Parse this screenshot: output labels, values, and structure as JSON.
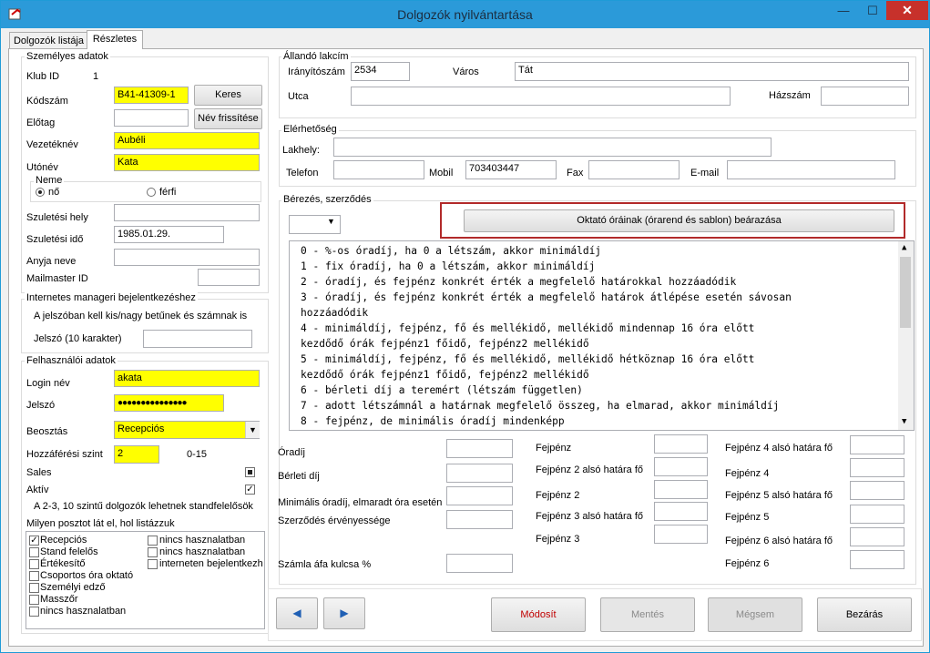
{
  "window": {
    "title": "Dolgozók nyilvántartása",
    "minimize": "—",
    "maximize": "☐",
    "close": "✕"
  },
  "tabs": [
    {
      "label": "Dolgozók listája"
    },
    {
      "label": "Részletes"
    }
  ],
  "personal": {
    "legend": "Személyes adatok",
    "klub_id_label": "Klub ID",
    "klub_id_value": "1",
    "kodszam_label": "Kódszám",
    "kodszam_value": "B41-41309-1",
    "keres_button": "Keres",
    "elotag_label": "Előtag",
    "elotag_value": "",
    "nev_frissites_button": "Név frissítése",
    "vezeteknev_label": "Vezetéknév",
    "vezeteknev_value": "Aubéli",
    "utonev_label": "Utónév",
    "utonev_value": "Kata",
    "neme_legend": "Neme",
    "neme_no": "nő",
    "neme_ferfi": "férfi",
    "szuletesi_hely_label": "Szuletési hely",
    "szuletesi_hely_value": "",
    "szuletesi_ido_label": "Szuletési idő",
    "szuletesi_ido_value": "1985.01.29.",
    "anyja_neve_label": "Anyja neve",
    "anyja_neve_value": "",
    "mailmaster_label": "Mailmaster ID",
    "mailmaster_value": ""
  },
  "internet": {
    "legend": "Internetes manageri bejelentkezéshez",
    "note": "A jelszóban kell kis/nagy betűnek és számnak is",
    "jelszo_label": "Jelszó (10 karakter)",
    "jelszo_value": ""
  },
  "user": {
    "legend": "Felhasználói adatok",
    "login_label": "Login név",
    "login_value": "akata",
    "jelszo_label": "Jelszó",
    "jelszo_value": "●●●●●●●●●●●●●●●",
    "beosztas_label": "Beosztás",
    "beosztas_value": "Recepciós",
    "hozzaferes_label": "Hozzáférési szint",
    "hozzaferes_value": "2",
    "hozzaferes_range": "0-15",
    "sales_label": "Sales",
    "aktiv_label": "Aktív",
    "standfelelos_note": "A 2-3, 10 szintű dolgozók lehetnek standfelelősök",
    "poszt_label": "Milyen posztot lát el, hol listázzuk",
    "posts_left": [
      {
        "label": "Recepciós",
        "checked": true
      },
      {
        "label": "Stand felelős",
        "checked": false
      },
      {
        "label": "Értékesítő",
        "checked": false
      },
      {
        "label": "Csoportos óra oktató",
        "checked": false
      },
      {
        "label": "Személyi edző",
        "checked": false
      },
      {
        "label": "Masszőr",
        "checked": false
      },
      {
        "label": "nincs hasznalatban",
        "checked": false
      }
    ],
    "posts_right": [
      {
        "label": "nincs hasznalatban",
        "checked": false
      },
      {
        "label": "nincs hasznalatban",
        "checked": false
      },
      {
        "label": "interneten bejelentkezh",
        "checked": false
      }
    ]
  },
  "address": {
    "legend": "Állandó lakcím",
    "iranyitoszam_label": "Irányítószám",
    "iranyitoszam_value": "2534",
    "varos_label": "Város",
    "varos_value": "Tát",
    "utca_label": "Utca",
    "utca_value": "",
    "hazszam_label": "Házszám",
    "hazszam_value": ""
  },
  "contact": {
    "legend": "Elérhetőség",
    "lakhely_label": "Lakhely:",
    "lakhely_value": "",
    "telefon_label": "Telefon",
    "telefon_value": "",
    "mobil_label": "Mobil",
    "mobil_value": "703403447",
    "fax_label": "Fax",
    "fax_value": "",
    "email_label": "E-mail",
    "email_value": ""
  },
  "salary": {
    "legend": "Bérezés, szerződés",
    "combo_value": "",
    "pricing_button": "Oktató óráinak (órarend és sablon) beárazása",
    "modes": [
      "0 - %-os óradíj, ha 0 a létszám, akkor minimáldíj",
      "1 - fix óradíj, ha 0 a létszám, akkor minimáldíj",
      "2 - óradíj, és fejpénz konkrét érték a megfelelő határokkal hozzáadódik",
      "3 - óradíj, és fejpénz konkrét érték a megfelelő határok átlépése esetén sávosan",
      "hozzáadódik",
      "4 - minimáldíj, fejpénz, fő és mellékidő, mellékidő mindennap 16 óra előtt",
      "kezdődő órák fejpénz1 főidő, fejpénz2 mellékidő",
      "5 - minimáldíj, fejpénz, fő és mellékidő, mellékidő hétköznap 16 óra előtt",
      "kezdődő órák fejpénz1 főidő, fejpénz2 mellékidő",
      "6 - bérleti díj a teremért (létszám független)",
      "7 - adott létszámnál a határnak megfelelő összeg, ha elmarad, akkor minimáldíj",
      "8 - fejpénz, de minimális óradíj mindenképp"
    ],
    "oradij_label": "Óradíj",
    "berleti_label": "Bérleti díj",
    "minimalis_label": "Minimális óradíj, elmaradt óra esetén",
    "szerzodes_label": "Szerződés érvényessége",
    "afa_label": "Számla áfa kulcsa %",
    "mid_labels": [
      "Fejpénz",
      "Fejpénz 2 alsó határa fő",
      "Fejpénz 2",
      "Fejpénz 3 alsó határa fő",
      "Fejpénz 3"
    ],
    "right_labels": [
      "Fejpénz 4 alsó határa fő",
      "Fejpénz 4",
      "Fejpénz 5 alsó határa fő",
      "Fejpénz 5",
      "Fejpénz 6 alsó határa fő",
      "Fejpénz 6"
    ]
  },
  "bottom": {
    "prev": "◀",
    "next": "▶",
    "modosit": "Módosít",
    "mentes": "Mentés",
    "megsem": "Mégsem",
    "bezaras": "Bezárás",
    "modosit_color": "#c00000"
  }
}
